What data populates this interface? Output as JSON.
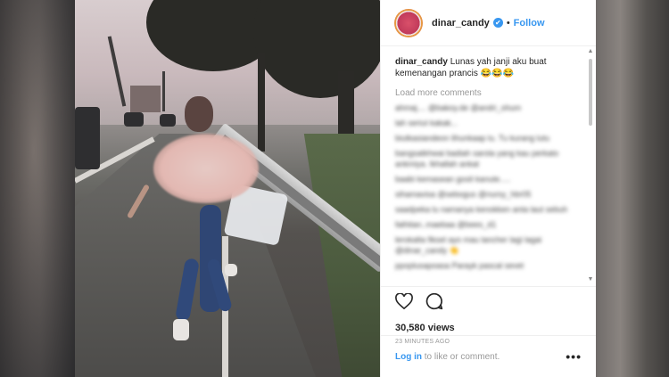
{
  "post": {
    "username": "dinar_candy",
    "verified_symbol": "✔",
    "separator": "•",
    "follow_label": "Follow",
    "caption_user": "dinar_candy",
    "caption_text": " Lunas yah janji aku buat kemenangan prancis 😂😂😂",
    "load_more_label": "Load more comments",
    "blurred_comments": [
      "ahmaj.... @bakoy.de @andri_ohum",
      "lah seriut kakak...",
      "biutkasiandeon lihunkaap lu. Tu kurang lutu",
      "bangsatkhwai badiah sarola yang kau perkato ankmiya. Ikhallah ankat",
      "baabi kemasean gosit kanute.....",
      "sihamavisa @sebogus @nursy_hbr05",
      "saadpeka lu namanya kenokken anta laut sebuh",
      "fathitan..maebaa @bees_d1",
      "lerokalta fiksel ayo mau lancher lagi lagai @dinar_candy 👏",
      "ppoplusapoasa Parayk pascal sevet"
    ],
    "views": "30,580 views",
    "timestamp": "23 MINUTES AGO",
    "login_link": "Log in",
    "login_suffix": " to like or comment.",
    "more_label": "•••"
  },
  "colors": {
    "accent_blue": "#3897f0",
    "text_dark": "#262626",
    "text_muted": "#999999"
  },
  "icons": [
    "heart-icon",
    "comment-icon",
    "more-options-icon",
    "verified-badge-icon"
  ]
}
